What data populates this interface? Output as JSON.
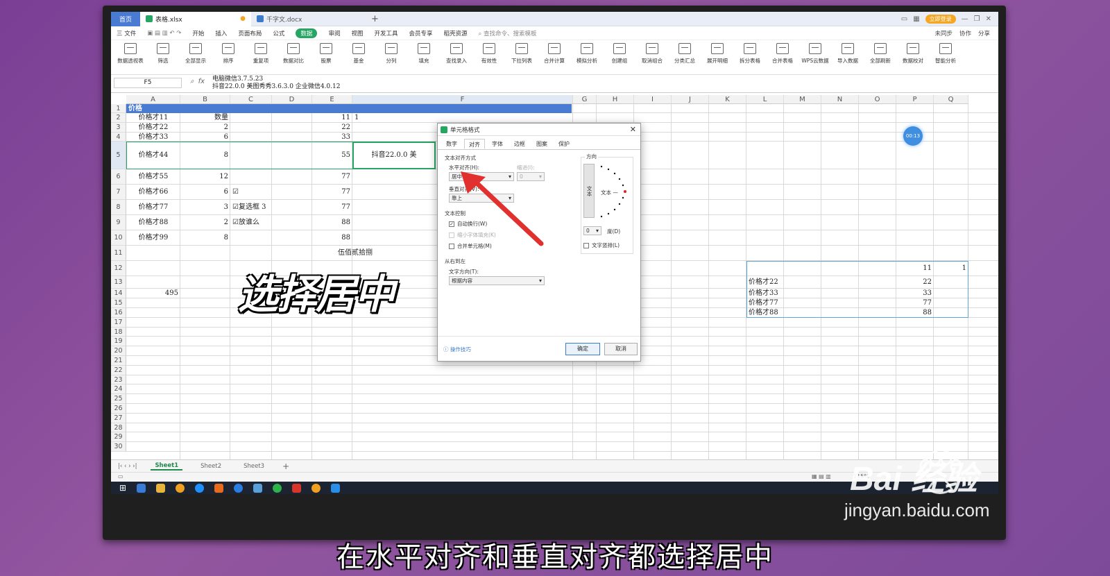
{
  "tabs": [
    {
      "label": "首页"
    },
    {
      "label": "表格.xlsx"
    },
    {
      "label": "千字文.docx"
    }
  ],
  "login_label": "立即登录",
  "menu": [
    "三 文件",
    "开始",
    "插入",
    "页面布局",
    "公式",
    "数据",
    "审阅",
    "视图",
    "开发工具",
    "会员专享",
    "稻壳资源"
  ],
  "menu_search": "查找命令、搜索模板",
  "menu_right": [
    "未同步",
    "协作",
    "分享"
  ],
  "ribbon": [
    "数据透视表",
    "筛选",
    "全部显示",
    "排序",
    "重复项",
    "数据对比",
    "股票",
    "基金",
    "分列",
    "填充",
    "查找录入",
    "有效性",
    "下拉列表",
    "合并计算",
    "模拟分析",
    "创建组",
    "取消组合",
    "分类汇总",
    "展开明细",
    "拆分表格",
    "合并表格",
    "WPS云数据",
    "导入数据",
    "全部刷新",
    "数据校对",
    "智能分析"
  ],
  "formula": {
    "namebox": "F5",
    "line1": "电脑微信3.7.5.23",
    "line2": "抖音22.0.0 美图秀秀3.6.3.0 企业微信4.0.12"
  },
  "columns": [
    "A",
    "B",
    "C",
    "D",
    "E",
    "F",
    "G",
    "H",
    "I",
    "J",
    "K",
    "L",
    "M",
    "N",
    "O",
    "P",
    "Q"
  ],
  "rows": [
    "1",
    "2",
    "3",
    "4",
    "5",
    "6",
    "7",
    "8",
    "9",
    "10",
    "11",
    "12",
    "13",
    "14",
    "15",
    "16",
    "17",
    "18",
    "19",
    "20",
    "21",
    "22",
    "23",
    "24",
    "25",
    "26",
    "27",
    "28",
    "29",
    "30"
  ],
  "cells": {
    "a1": "价格",
    "a2": "价格才11",
    "b2": "数量",
    "e2": "11",
    "f2": "1",
    "a3": "价格才22",
    "b3": "2",
    "e3": "22",
    "a4": "价格才33",
    "b4": "6",
    "e4": "33",
    "a5": "价格才44",
    "b5": "8",
    "e5": "55",
    "f5": "抖音22.0.0 美",
    "a6": "价格才55",
    "b6": "12",
    "e6": "77",
    "a7": "价格才66",
    "b7": "6",
    "c7": "☑",
    "e7": "77",
    "a8": "价格才77",
    "b8": "3",
    "c8": "☑复选框 3",
    "e8": "77",
    "a9": "价格才88",
    "b9": "2",
    "c9": "☑放谁么",
    "e9": "88",
    "a10": "价格才99",
    "b10": "8",
    "e10": "88",
    "e11": "伍佰贰拾捌",
    "a14": "495",
    "p12": "11",
    "q12": "1",
    "l13": "价格才22",
    "p13": "22",
    "l14": "价格才33",
    "p14": "33",
    "l15": "价格才77",
    "p15": "77",
    "l16": "价格才88",
    "p16": "88"
  },
  "sheets": [
    "Sheet1",
    "Sheet2",
    "Sheet3"
  ],
  "zoom": "115%",
  "timer": "00:13",
  "dialog": {
    "title": "单元格格式",
    "tabs": [
      "数字",
      "对齐",
      "字体",
      "边框",
      "图案",
      "保护"
    ],
    "text_align_section": "文本对齐方式",
    "h_align_label": "水平对齐(H):",
    "h_align_value": "居中",
    "indent_label": "缩进(I):",
    "indent_value": "0",
    "v_align_label": "垂直对齐(V):",
    "v_align_value": "靠上",
    "text_control_section": "文本控制",
    "wrap": "自动换行(W)",
    "shrink": "缩小字体填充(K)",
    "merge": "合并单元格(M)",
    "rtl_section": "从右到左",
    "text_dir_label": "文字方向(T):",
    "text_dir_value": "根据内容",
    "orient_section": "方向",
    "orient_vertical": "文本",
    "orient_horizontal": "文本 —",
    "degree_value": "0",
    "degree_label": "度(D)",
    "vertical_text": "文字竖排(L)",
    "tips": "操作技巧",
    "ok": "确定",
    "cancel": "取消"
  },
  "overlay_caption": "选择居中",
  "bottom_caption": "在水平对齐和垂直对齐都选择居中",
  "watermark": {
    "brand": "Bai 经验",
    "url": "jingyan.baidu.com"
  },
  "colors": {
    "accent_green": "#27a563",
    "header_blue": "#4a7bd3",
    "arrow_red": "#e0312f"
  }
}
